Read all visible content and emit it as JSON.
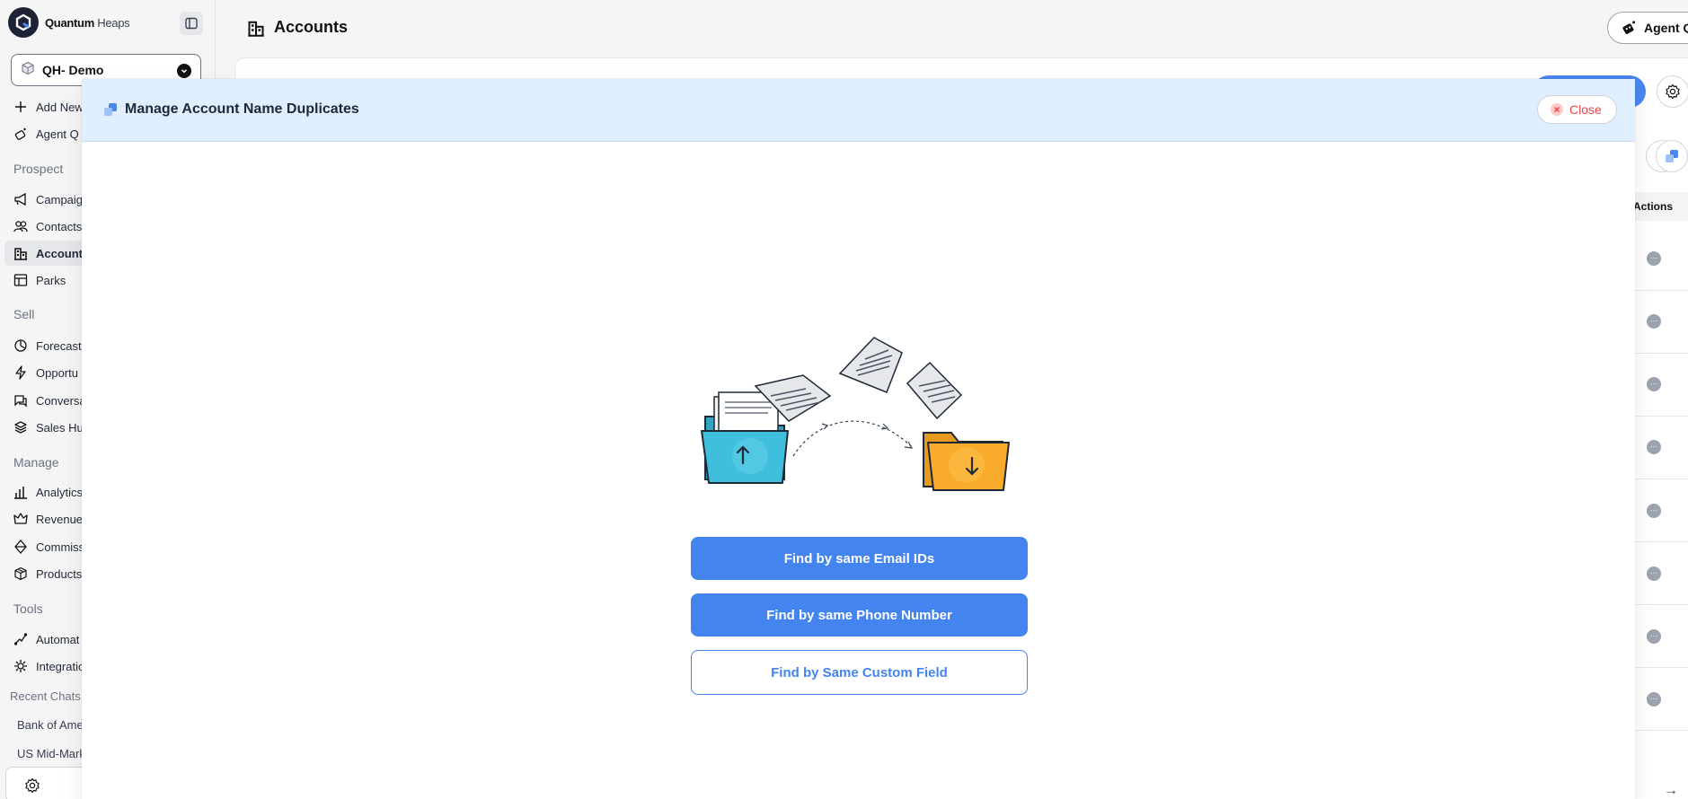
{
  "brand": {
    "name_bold": "Quantum",
    "name_light": " Heaps"
  },
  "workspace": {
    "label": "QH- Demo"
  },
  "sidebar": {
    "top_items": [
      {
        "label": "Add New"
      },
      {
        "label": "Agent Q"
      }
    ],
    "sections": {
      "prospect": "Prospect",
      "sell": "Sell",
      "manage": "Manage",
      "tools": "Tools"
    },
    "prospect_items": [
      {
        "label": "Campaig"
      },
      {
        "label": "Contacts"
      },
      {
        "label": "Account"
      },
      {
        "label": "Parks"
      }
    ],
    "sell_items": [
      {
        "label": "Forecast"
      },
      {
        "label": "Opportu"
      },
      {
        "label": "Conversa"
      },
      {
        "label": "Sales Hul"
      }
    ],
    "manage_items": [
      {
        "label": "Analytics"
      },
      {
        "label": "Revenue"
      },
      {
        "label": "Commiss"
      },
      {
        "label": "Products"
      }
    ],
    "tools_items": [
      {
        "label": "Automat"
      },
      {
        "label": "Integratio"
      }
    ],
    "recent_heading": "Recent Chats",
    "recent_items": [
      {
        "label": "Bank of Ame"
      },
      {
        "label": "US Mid-Mark"
      }
    ],
    "active_item": "Account"
  },
  "header": {
    "title": "Accounts",
    "agent_button": "Agent Q"
  },
  "background_table": {
    "actions_header": "Actions",
    "row_action": "···"
  },
  "modal": {
    "title": "Manage Account Name Duplicates",
    "close_label": "Close",
    "buttons": {
      "email": "Find by same Email IDs",
      "phone": "Find by same Phone Number",
      "custom": "Find by Same Custom Field"
    }
  },
  "colors": {
    "primary": "#4384ef",
    "modal_header": "#e0efff",
    "close_red": "#ef4444",
    "folder_blue": "#3fbfdc",
    "folder_orange": "#f9ab2b"
  },
  "icons": [
    "logo-icon",
    "sidebar-toggle-icon",
    "cube-icon",
    "chevron-down-icon",
    "plus-icon",
    "agent-icon",
    "megaphone-icon",
    "contacts-icon",
    "building-icon",
    "layout-icon",
    "forecast-icon",
    "bolt-icon",
    "chat-icon",
    "layers-icon",
    "chart-icon",
    "crown-icon",
    "diamond-icon",
    "box-icon",
    "automation-icon",
    "integration-icon",
    "gear-icon",
    "duplicate-icon",
    "close-icon"
  ]
}
